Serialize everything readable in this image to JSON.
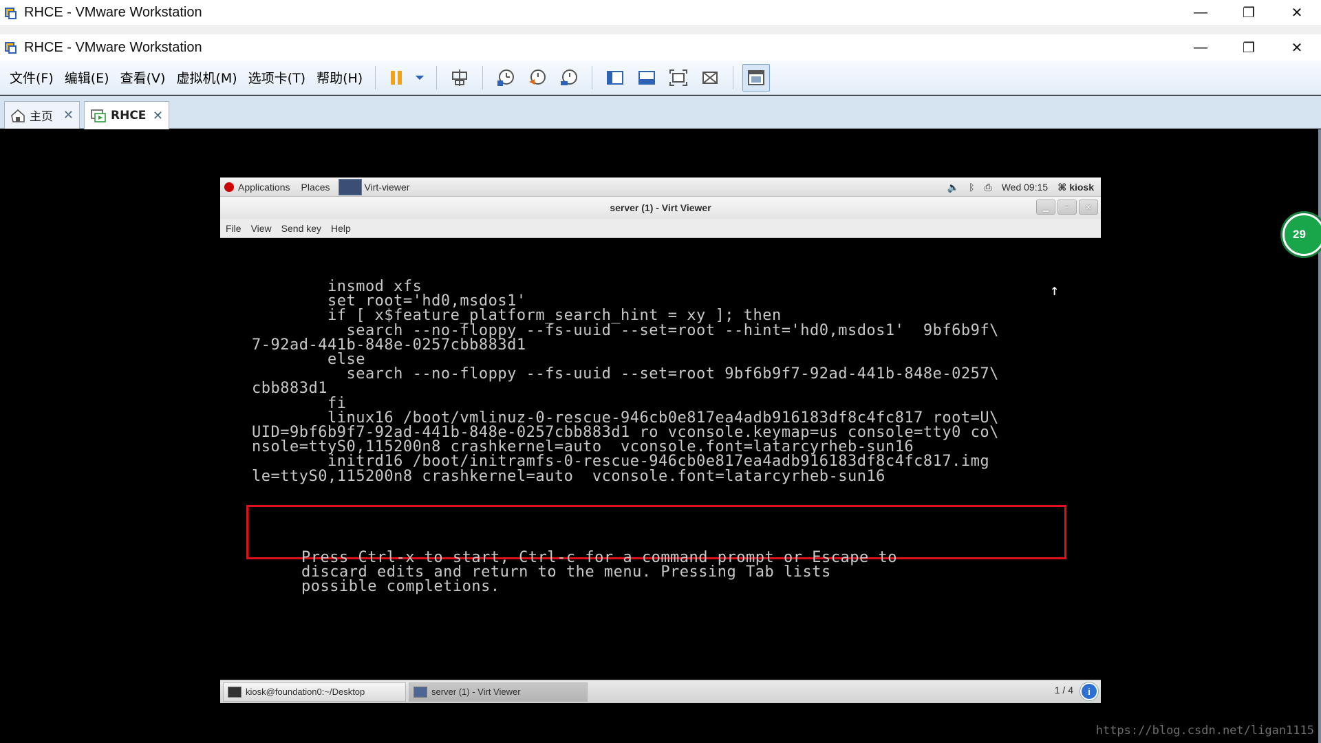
{
  "window": {
    "title_back": "RHCE - VMware Workstation",
    "title_front": "RHCE - VMware Workstation",
    "minimize": "—",
    "restore": "❐",
    "close": "✕"
  },
  "menu": [
    "文件(F)",
    "编辑(E)",
    "查看(V)",
    "虚拟机(M)",
    "选项卡(T)",
    "帮助(H)"
  ],
  "tabs": [
    {
      "label": "主页",
      "icon": "home-icon",
      "close": "✕"
    },
    {
      "label": "RHCE",
      "icon": "vm-icon",
      "close": "✕"
    }
  ],
  "side_badge": "29",
  "gnome_panel": {
    "applications": "Applications",
    "places": "Places",
    "task": "Virt-viewer",
    "time": "Wed 09:15",
    "user": "kiosk"
  },
  "viewer": {
    "title": "server (1) - Virt Viewer",
    "menu": [
      "File",
      "View",
      "Send key",
      "Help"
    ]
  },
  "console_lines": [
    "        insmod xfs",
    "        set root='hd0,msdos1'",
    "        if [ x$feature_platform_search_hint = xy ]; then",
    "          search --no-floppy --fs-uuid --set=root --hint='hd0,msdos1'  9bf6b9f\\",
    "7-92ad-441b-848e-0257cbb883d1",
    "        else",
    "          search --no-floppy --fs-uuid --set=root 9bf6b9f7-92ad-441b-848e-0257\\",
    "cbb883d1",
    "        fi",
    "        linux16 /boot/vmlinuz-0-rescue-946cb0e817ea4adb916183df8c4fc817 root=U\\",
    "UID=9bf6b9f7-92ad-441b-848e-0257cbb883d1 ro vconsole.keymap=us console=tty0 co\\",
    "nsole=ttyS0,115200n8 crashkernel=auto  vconsole.font=latarcyrheb-sun16",
    "        initrd16 /boot/initramfs-0-rescue-946cb0e817ea4adb916183df8c4fc817.img",
    "le=ttyS0,115200n8 crashkernel=auto  vconsole.font=latarcyrheb-sun16"
  ],
  "console_help": [
    "Press Ctrl-x to start, Ctrl-c for a command prompt or Escape to",
    "discard edits and return to the menu. Pressing Tab lists",
    "possible completions."
  ],
  "scroll_indicator": "↑",
  "taskbar": {
    "terminal": "kiosk@foundation0:~/Desktop",
    "viewer": "server (1) - Virt Viewer",
    "pager": "1 / 4",
    "info": "i"
  },
  "watermark": "https://blog.csdn.net/ligan1115",
  "colors": {
    "highlight_box": "#e0101a",
    "console_text": "#c8c8c8",
    "vm_background": "#000000"
  }
}
